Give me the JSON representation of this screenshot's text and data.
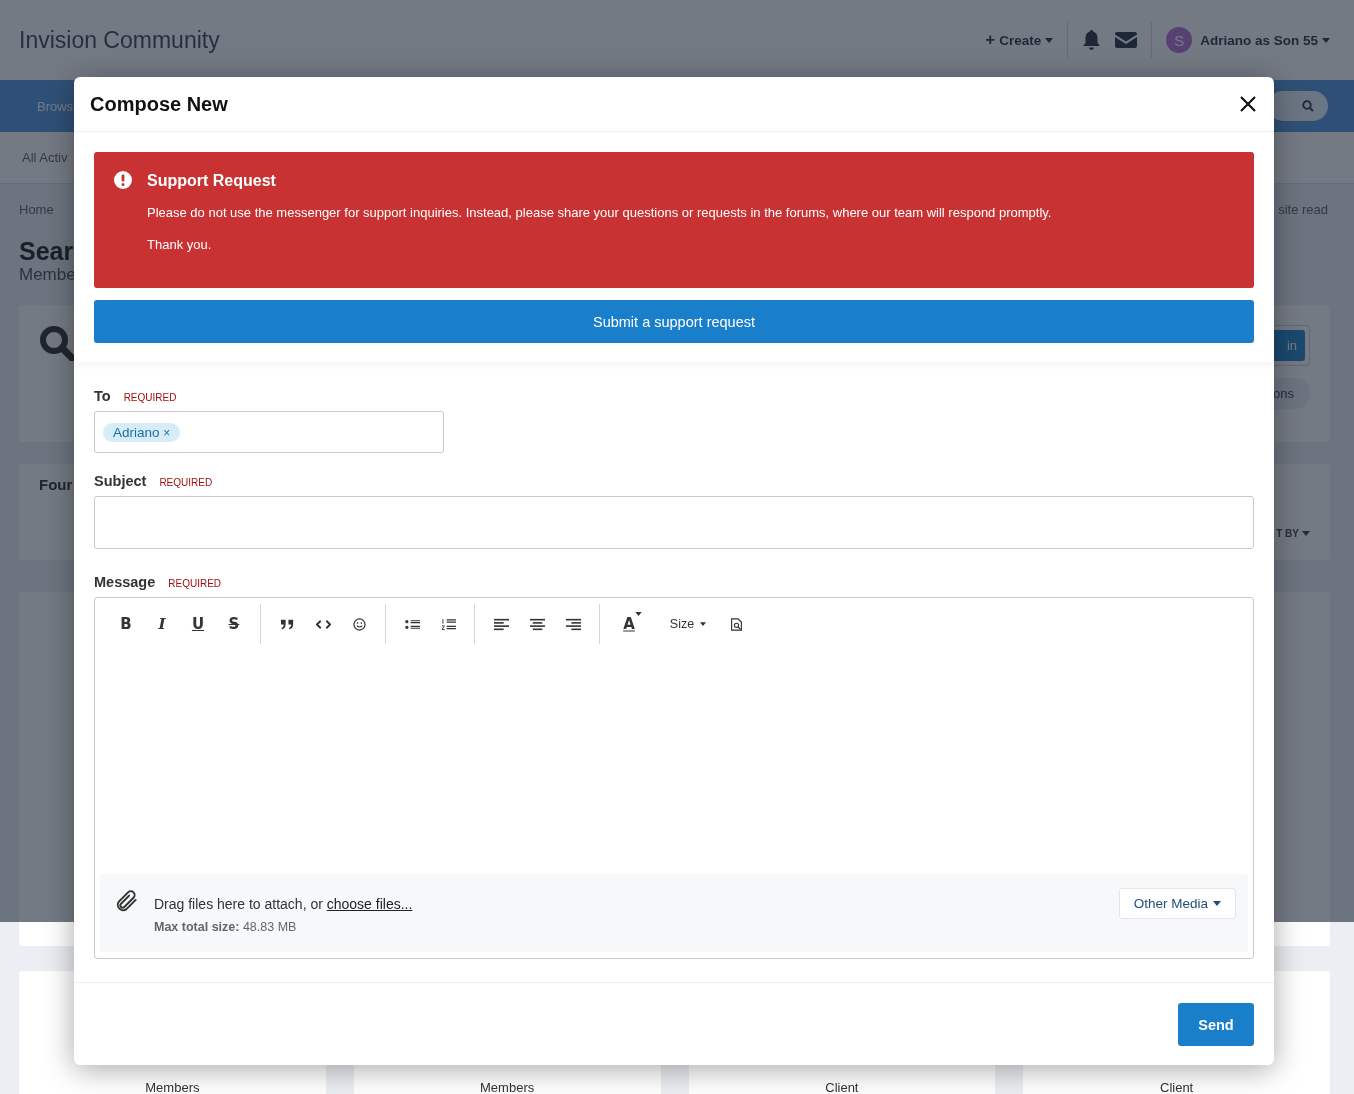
{
  "header": {
    "site_title": "Invision Community",
    "create_icon": "+",
    "create": "Create",
    "user_initial": "S",
    "user_name": "Adriano as Son 55"
  },
  "nav": {
    "item": "Brows"
  },
  "subnav": {
    "item": "All Activ"
  },
  "breadcrumb": {
    "home": "Home",
    "mark_read": "site read"
  },
  "page_title": "Sear",
  "page_subtitle": "Membe",
  "search_panel": {
    "button": "in",
    "option": "ons"
  },
  "results": {
    "title": "Four",
    "sort": "T BY"
  },
  "member_cards": [
    {
      "group": "Members"
    },
    {
      "group": "Members"
    },
    {
      "group": "Client"
    },
    {
      "group": "Client"
    }
  ],
  "modal": {
    "title": "Compose New",
    "alert": {
      "title": "Support Request",
      "body": "Please do not use the messenger for support inquiries. Instead, please share your questions or requests in the forums, where our team will respond promptly.",
      "closing": "Thank you."
    },
    "support_button": "Submit a support request",
    "fields": [
      {
        "label": "To",
        "required": "REQUIRED",
        "kind": "tags",
        "tags": [
          {
            "name": "Adriano",
            "remove": "×"
          }
        ]
      },
      {
        "label": "Subject",
        "required": "REQUIRED",
        "kind": "text"
      },
      {
        "label": "Message",
        "required": "REQUIRED",
        "kind": "editor"
      }
    ],
    "toolbar": [
      [
        {
          "kind": "bold",
          "label": "B"
        },
        {
          "kind": "italic",
          "label": "I"
        },
        {
          "kind": "underline",
          "label": "U"
        },
        {
          "kind": "strike",
          "label": "S"
        }
      ],
      [
        {
          "kind": "quote"
        },
        {
          "kind": "code"
        },
        {
          "kind": "emoji"
        }
      ],
      [
        {
          "kind": "bullets"
        },
        {
          "kind": "numbers"
        }
      ],
      [
        {
          "kind": "align-left"
        },
        {
          "kind": "align-center"
        },
        {
          "kind": "align-right"
        }
      ],
      [
        {
          "kind": "color",
          "label": "A"
        },
        {
          "kind": "size",
          "label": "Size"
        },
        {
          "kind": "preview"
        }
      ]
    ],
    "attachments": {
      "text": "Drag files here to attach, or ",
      "link": "choose files...",
      "max_label": "Max total size:",
      "max_value": "48.83 MB",
      "other_media": "Other Media"
    },
    "send": "Send"
  }
}
